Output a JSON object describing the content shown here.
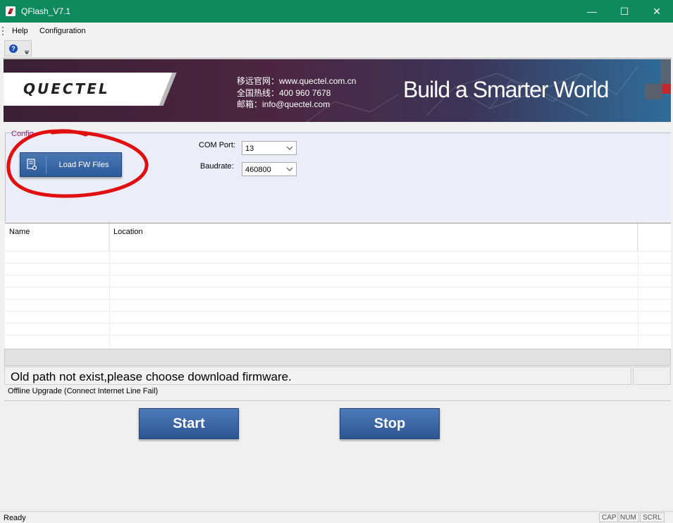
{
  "window": {
    "title": "QFlash_V7.1",
    "titlebar_color": "#0f8a5f",
    "controls": {
      "minimize": "—",
      "maximize": "☐",
      "close": "✕"
    }
  },
  "menu": {
    "items": [
      "Help",
      "Configuration"
    ]
  },
  "toolbar": {
    "help_icon": "help-icon",
    "help_glyph": "?"
  },
  "banner": {
    "logo": "QUECTEL",
    "contact_lines": [
      "移远官网：www.quectel.com.cn",
      "全国热线：400 960 7678",
      "邮箱：info@quectel.com"
    ],
    "slogan": "Build a Smarter World",
    "accent_red": "#c1272d"
  },
  "config": {
    "group_label": "Config",
    "load_button_label": "Load FW Files",
    "com_port_label": "COM Port:",
    "com_port_value": "13",
    "baudrate_label": "Baudrate:",
    "baudrate_value": "460800"
  },
  "file_table": {
    "columns": [
      "Name",
      "Location"
    ],
    "rows": []
  },
  "messages": {
    "main": "Old path not exist,please choose download firmware.",
    "info": "Offline Upgrade (Connect Internet Line Fail)"
  },
  "actions": {
    "start": "Start",
    "stop": "Stop"
  },
  "statusbar": {
    "text": "Ready",
    "indicators": [
      "CAP",
      "NUM",
      "SCRL"
    ]
  },
  "annotation": {
    "circle_color": "#e01010"
  }
}
